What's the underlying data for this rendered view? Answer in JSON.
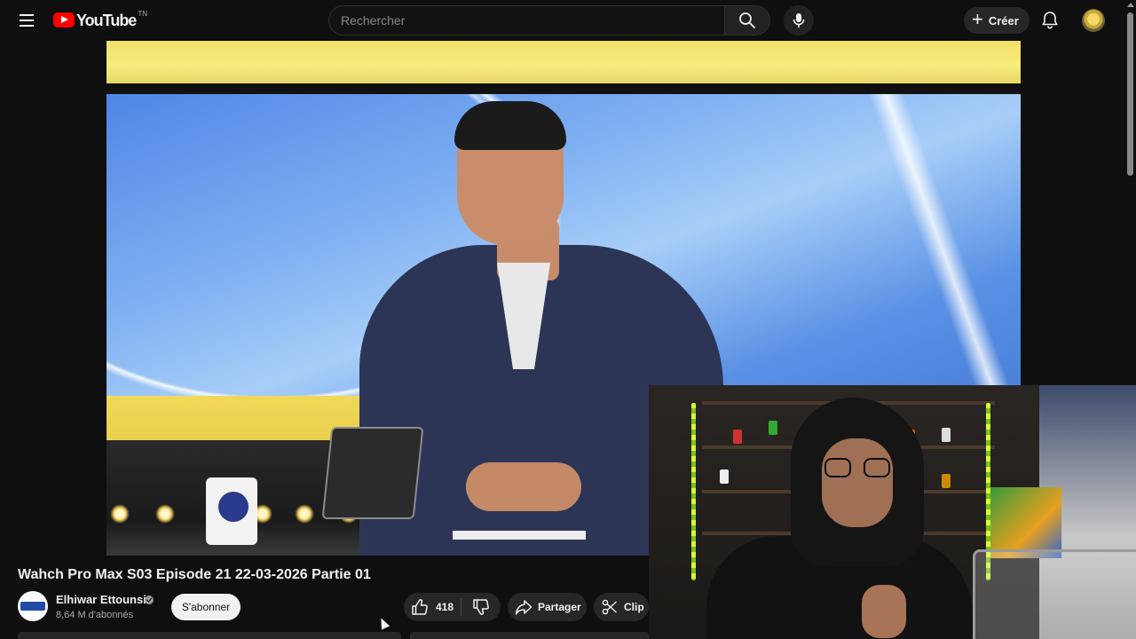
{
  "header": {
    "logo_text": "YouTube",
    "region_code": "TN",
    "search": {
      "placeholder": "Rechercher",
      "value": ""
    },
    "create_label": "Créer"
  },
  "video": {
    "title": "Wahch Pro Max S03 Episode 21 22-03-2026 Partie 01"
  },
  "channel": {
    "name": "Elhiwar Ettounsi",
    "subscribers": "8,64 M d'abonnés",
    "subscribe_label": "S'abonner",
    "verified": true
  },
  "actions": {
    "like_count": "418",
    "share_label": "Partager",
    "clip_label": "Clip"
  },
  "icons": {
    "menu": "hamburger-menu-icon",
    "search": "search-icon",
    "mic": "microphone-icon",
    "create": "plus-icon",
    "notifications": "bell-icon",
    "like": "thumbs-up-icon",
    "dislike": "thumbs-down-icon",
    "share": "share-arrow-icon",
    "clip": "scissors-icon"
  },
  "colors": {
    "background": "#0f0f0f",
    "brand_red": "#ff0000",
    "pill": "#272727",
    "text": "#f1f1f1",
    "muted": "#aaaaaa"
  }
}
